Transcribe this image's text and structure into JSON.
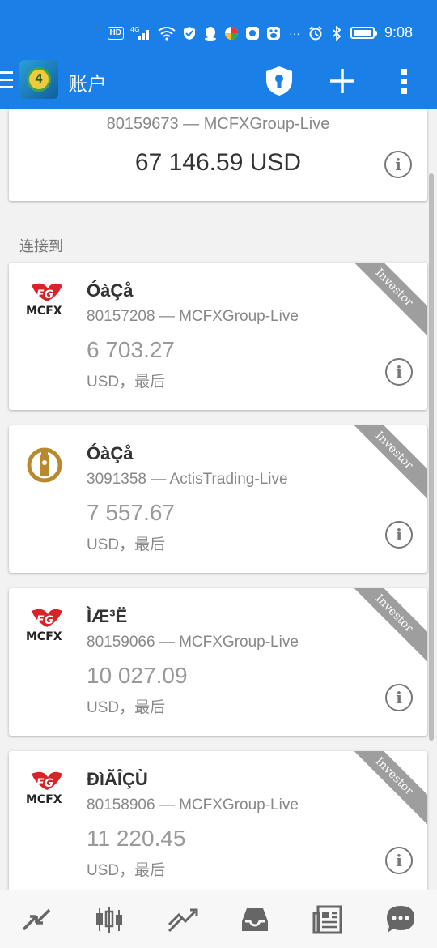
{
  "status": {
    "time": "9:08",
    "network": "4G",
    "hd": "HD",
    "icons": [
      "hd-icon",
      "signal-icon",
      "wifi-icon",
      "shield-check-icon",
      "qq-icon",
      "color-app-icon",
      "app-icon",
      "baidu-icon",
      "more-dots-icon",
      "alarm-icon",
      "bluetooth-icon",
      "battery-icon"
    ]
  },
  "appbar": {
    "title": "账户",
    "logo_text": "4",
    "actions": [
      "shield-lock-icon",
      "add-icon",
      "overflow-menu-icon"
    ]
  },
  "current_account": {
    "account_line": "80159673 — MCFXGroup-Live",
    "balance": "67 146.59 USD"
  },
  "section_label": "连接到",
  "accounts": [
    {
      "name": "ÓàÇå",
      "account_line": "80157208 — MCFXGroup-Live",
      "balance": "6 703.27",
      "currency": "USD，最后",
      "logo": "mcfx",
      "logo_text": "MCFX",
      "badge": "Investor"
    },
    {
      "name": "ÓàÇå",
      "account_line": "3091358 — ActisTrading-Live",
      "balance": "7 557.67",
      "currency": "USD，最后",
      "logo": "actis",
      "logo_text": "",
      "badge": "Investor"
    },
    {
      "name": "ÌÆ³Ë",
      "account_line": "80159066 — MCFXGroup-Live",
      "balance": "10 027.09",
      "currency": "USD，最后",
      "logo": "mcfx",
      "logo_text": "MCFX",
      "badge": "Investor"
    },
    {
      "name": "ÐìÃÎÇÙ",
      "account_line": "80158906 — MCFXGroup-Live",
      "balance": "11 220.45",
      "currency": "USD，最后",
      "logo": "mcfx",
      "logo_text": "MCFX",
      "badge": "Investor"
    }
  ],
  "bottom_nav": [
    "quotes-icon",
    "chart-candles-icon",
    "trade-icon",
    "history-inbox-icon",
    "news-icon",
    "chat-icon"
  ],
  "colors": {
    "primary": "#1a7fe6",
    "ribbon": "#9e9e9e",
    "mcfx_red": "#d8232a"
  }
}
